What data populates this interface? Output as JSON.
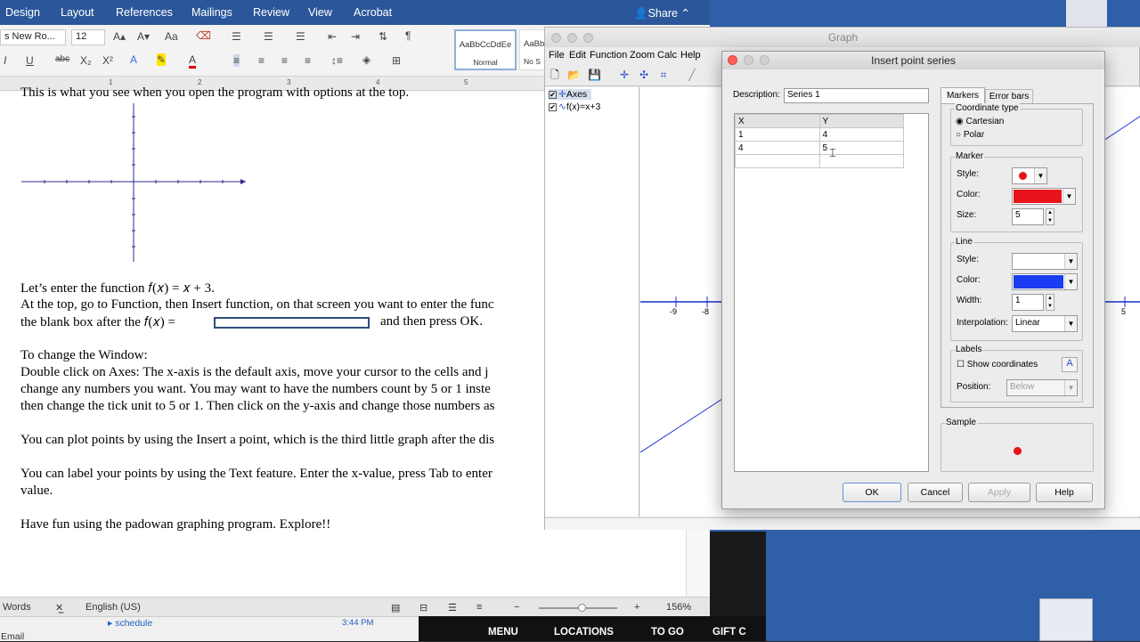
{
  "word": {
    "menu_tabs": [
      "Design",
      "Layout",
      "References",
      "Mailings",
      "Review",
      "View",
      "Acrobat"
    ],
    "share": "Share",
    "font_name": "s New Ro...",
    "font_size": "12",
    "style_normal": "AaBbCcDdEe",
    "style_normal_label": "Normal",
    "style_nospace": "AaBb",
    "style_nospace_label": "No S",
    "ruler_numbers": [
      "1",
      "2",
      "3",
      "4",
      "5"
    ],
    "doc_lines": [
      "This is what you see when you open the program with options at the top.",
      "Let’s enter the function 𝑓(𝑥) = 𝑥 + 3.",
      "At the top, go to Function, then Insert function, on that screen you want to enter the func",
      "the blank box after the 𝑓(𝑥) =",
      "and then press OK.",
      "To change the Window:",
      "Double click on Axes:  The x-axis is the default axis, move your cursor to the cells and j",
      "change any numbers you want.  You may want to have the numbers count by 5 or 1 inste",
      "then change the tick unit to 5 or 1. Then click on the y-axis and change those numbers as",
      "You can plot points by using the Insert a point, which is the third little graph after the dis",
      "You can label your points by using the Text feature. Enter the x-value, press Tab to enter",
      "value.",
      "Have fun using the padowan graphing program. Explore!!"
    ],
    "status_words": "Words",
    "status_language": "English (US)",
    "zoom": "156%"
  },
  "graph_window": {
    "title": "Graph",
    "menu": [
      "File",
      "Edit",
      "Function",
      "Zoom",
      "Calc",
      "Help"
    ],
    "tree": [
      "Axes",
      "f(x)=x+3"
    ],
    "tick_labels": [
      "-9",
      "-8",
      "5"
    ]
  },
  "dialog": {
    "title": "Insert point series",
    "description_label": "Description:",
    "description_value": "Series 1",
    "tabs": [
      "Markers",
      "Error bars"
    ],
    "columns": [
      "X",
      "Y"
    ],
    "rows": [
      [
        "1",
        "4"
      ],
      [
        "4",
        "5"
      ],
      [
        "",
        ""
      ]
    ],
    "coordinate_type": {
      "title": "Coordinate type",
      "options": [
        "Cartesian",
        "Polar"
      ],
      "selected": "Cartesian"
    },
    "marker": {
      "title": "Marker",
      "style_label": "Style:",
      "color_label": "Color:",
      "color": "#e8141b",
      "size_label": "Size:",
      "size_value": "5"
    },
    "line": {
      "title": "Line",
      "style_label": "Style:",
      "color_label": "Color:",
      "color": "#1a3cf2",
      "width_label": "Width:",
      "width_value": "1",
      "interpolation_label": "Interpolation:",
      "interpolation_value": "Linear"
    },
    "labels": {
      "title": "Labels",
      "show_coordinates": "Show coordinates",
      "position_label": "Position:",
      "position_value": "Below"
    },
    "sample_title": "Sample",
    "buttons": [
      "OK",
      "Cancel",
      "Apply",
      "Help"
    ]
  },
  "taskbar": {
    "outlook_item": "schedule",
    "outlook_time": "3:44 PM",
    "outlook_email": "Email",
    "web_items": [
      "MENU",
      "LOCATIONS",
      "TO GO",
      "GIFT C"
    ]
  }
}
